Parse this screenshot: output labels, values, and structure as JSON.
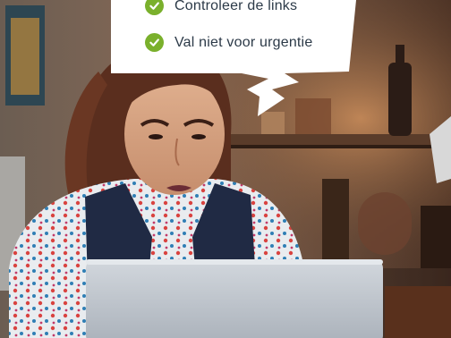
{
  "checklist": {
    "items": [
      {
        "label": "Controleer de links",
        "icon": "check-circle-icon"
      },
      {
        "label": "Val niet voor urgentie",
        "icon": "check-circle-icon"
      }
    ],
    "check_color": "#7ab02c",
    "text_color": "#2c3a48"
  },
  "photo": {
    "subject": "woman-frowning-at-laptop-icon",
    "laptop_color": "#c3c9d1"
  }
}
